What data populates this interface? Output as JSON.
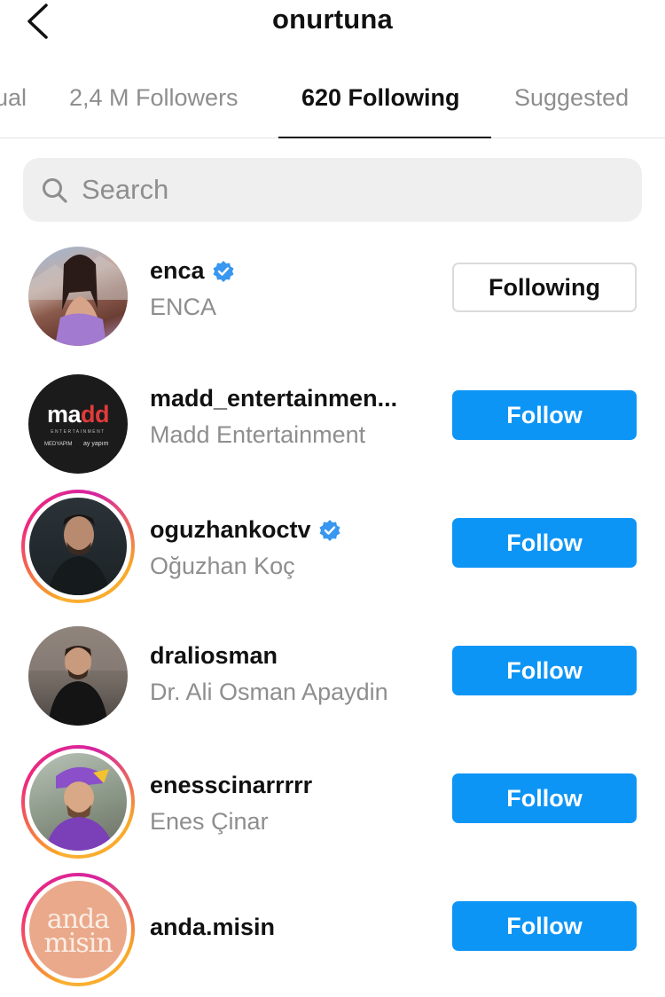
{
  "header": {
    "title": "onurtuna"
  },
  "tabs": [
    {
      "label": "ual",
      "active": false
    },
    {
      "label": "2,4 M Followers",
      "active": false
    },
    {
      "label": "620 Following",
      "active": true
    },
    {
      "label": "Suggested",
      "active": false
    }
  ],
  "search": {
    "placeholder": "Search",
    "value": ""
  },
  "accounts": [
    {
      "username": "enca",
      "full_name": "ENCA",
      "verified": true,
      "button": "Following",
      "story_ring": false
    },
    {
      "username": "madd_entertainmen...",
      "full_name": "Madd Entertainment",
      "verified": false,
      "button": "Follow",
      "story_ring": false
    },
    {
      "username": "oguzhankoctv",
      "full_name": "Oğuzhan Koç",
      "verified": true,
      "button": "Follow",
      "story_ring": true
    },
    {
      "username": "draliosman",
      "full_name": "Dr. Ali Osman Apaydin",
      "verified": false,
      "button": "Follow",
      "story_ring": false
    },
    {
      "username": "enesscinarrrrr",
      "full_name": "Enes Çinar",
      "verified": false,
      "button": "Follow",
      "story_ring": true
    },
    {
      "username": "anda.misin",
      "full_name": "",
      "verified": false,
      "button": "Follow",
      "story_ring": true
    }
  ],
  "logos": {
    "madd": {
      "main": "madd",
      "sub": "ENTERTAINMENT",
      "left": "MEDYAPIM",
      "right": "ay yapım"
    },
    "anda": {
      "line1": "anda",
      "line2": "misin"
    }
  },
  "colors": {
    "follow_button": "#0d95f6",
    "verified_badge": "#3897f0",
    "muted_text": "#8e8e8e",
    "search_bg": "#efefef"
  }
}
